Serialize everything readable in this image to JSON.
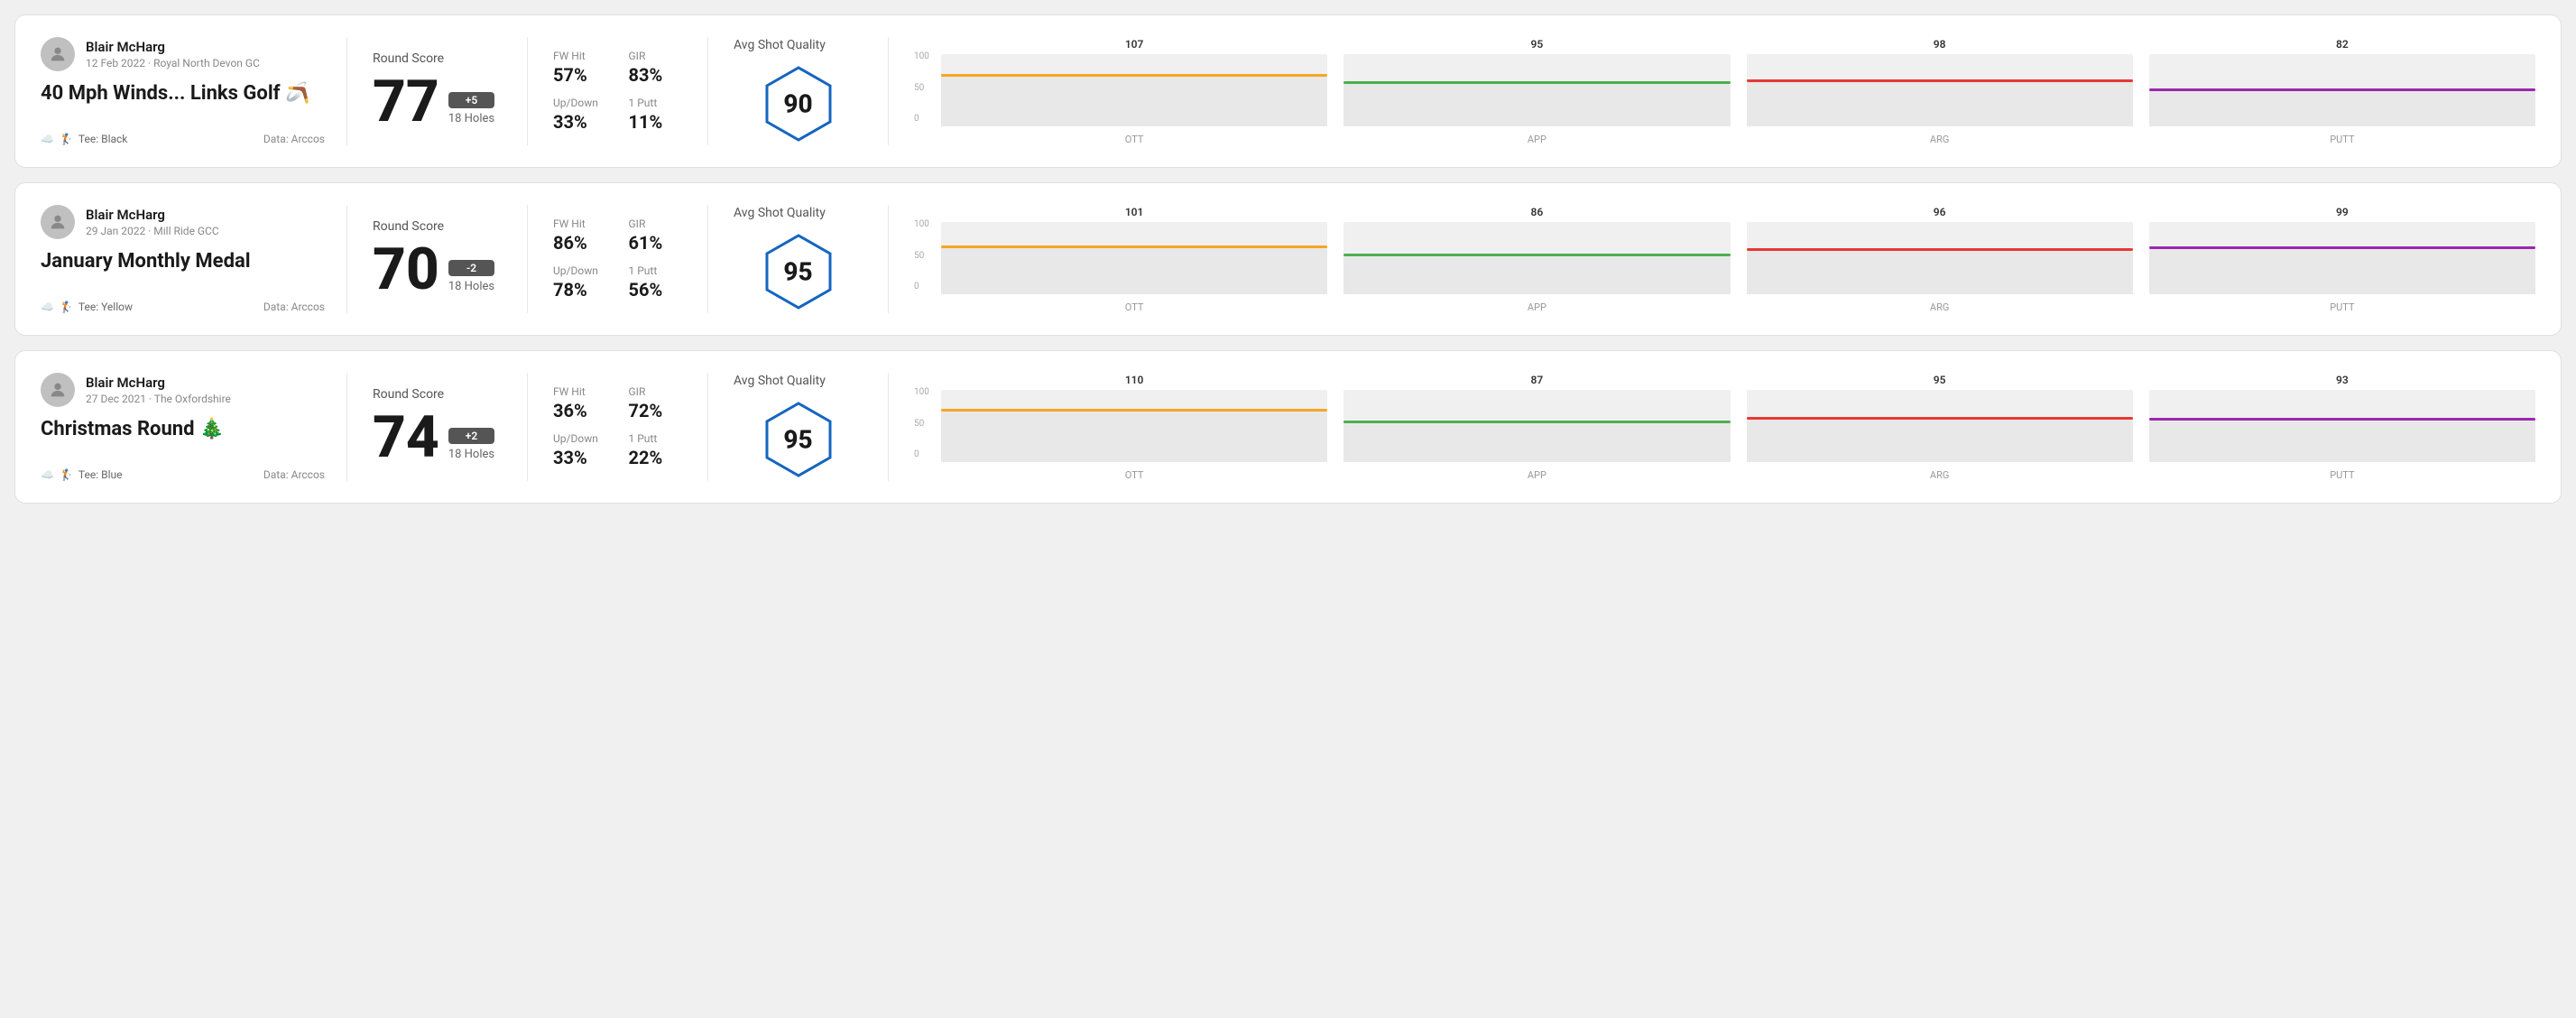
{
  "rounds": [
    {
      "id": "round-1",
      "user": {
        "name": "Blair McHarg",
        "date_course": "12 Feb 2022 · Royal North Devon GC"
      },
      "title": "40 Mph Winds... Links Golf 🪃",
      "tee": "Black",
      "data_source": "Data: Arccos",
      "score": "77",
      "score_diff": "+5",
      "holes": "18 Holes",
      "stats": [
        {
          "label": "FW Hit",
          "value": "57%"
        },
        {
          "label": "GIR",
          "value": "83%"
        },
        {
          "label": "Up/Down",
          "value": "33%"
        },
        {
          "label": "1 Putt",
          "value": "11%"
        }
      ],
      "avg_quality": "90",
      "chart": {
        "bars": [
          {
            "label": "OTT",
            "value": 107,
            "color": "#f5a623",
            "fill_pct": 72
          },
          {
            "label": "APP",
            "value": 95,
            "color": "#4caf50",
            "fill_pct": 62
          },
          {
            "label": "ARG",
            "value": 98,
            "color": "#e53935",
            "fill_pct": 65
          },
          {
            "label": "PUTT",
            "value": 82,
            "color": "#9c27b0",
            "fill_pct": 53
          }
        ]
      }
    },
    {
      "id": "round-2",
      "user": {
        "name": "Blair McHarg",
        "date_course": "29 Jan 2022 · Mill Ride GCC"
      },
      "title": "January Monthly Medal",
      "tee": "Yellow",
      "data_source": "Data: Arccos",
      "score": "70",
      "score_diff": "-2",
      "holes": "18 Holes",
      "stats": [
        {
          "label": "FW Hit",
          "value": "86%"
        },
        {
          "label": "GIR",
          "value": "61%"
        },
        {
          "label": "Up/Down",
          "value": "78%"
        },
        {
          "label": "1 Putt",
          "value": "56%"
        }
      ],
      "avg_quality": "95",
      "chart": {
        "bars": [
          {
            "label": "OTT",
            "value": 101,
            "color": "#f5a623",
            "fill_pct": 68
          },
          {
            "label": "APP",
            "value": 86,
            "color": "#4caf50",
            "fill_pct": 56
          },
          {
            "label": "ARG",
            "value": 96,
            "color": "#e53935",
            "fill_pct": 64
          },
          {
            "label": "PUTT",
            "value": 99,
            "color": "#9c27b0",
            "fill_pct": 66
          }
        ]
      }
    },
    {
      "id": "round-3",
      "user": {
        "name": "Blair McHarg",
        "date_course": "27 Dec 2021 · The Oxfordshire"
      },
      "title": "Christmas Round 🎄",
      "tee": "Blue",
      "data_source": "Data: Arccos",
      "score": "74",
      "score_diff": "+2",
      "holes": "18 Holes",
      "stats": [
        {
          "label": "FW Hit",
          "value": "36%"
        },
        {
          "label": "GIR",
          "value": "72%"
        },
        {
          "label": "Up/Down",
          "value": "33%"
        },
        {
          "label": "1 Putt",
          "value": "22%"
        }
      ],
      "avg_quality": "95",
      "chart": {
        "bars": [
          {
            "label": "OTT",
            "value": 110,
            "color": "#f5a623",
            "fill_pct": 74
          },
          {
            "label": "APP",
            "value": 87,
            "color": "#4caf50",
            "fill_pct": 57
          },
          {
            "label": "ARG",
            "value": 95,
            "color": "#e53935",
            "fill_pct": 63
          },
          {
            "label": "PUTT",
            "value": 93,
            "color": "#9c27b0",
            "fill_pct": 61
          }
        ]
      }
    }
  ],
  "labels": {
    "round_score": "Round Score",
    "avg_shot_quality": "Avg Shot Quality",
    "data_arccos": "Data: Arccos"
  }
}
